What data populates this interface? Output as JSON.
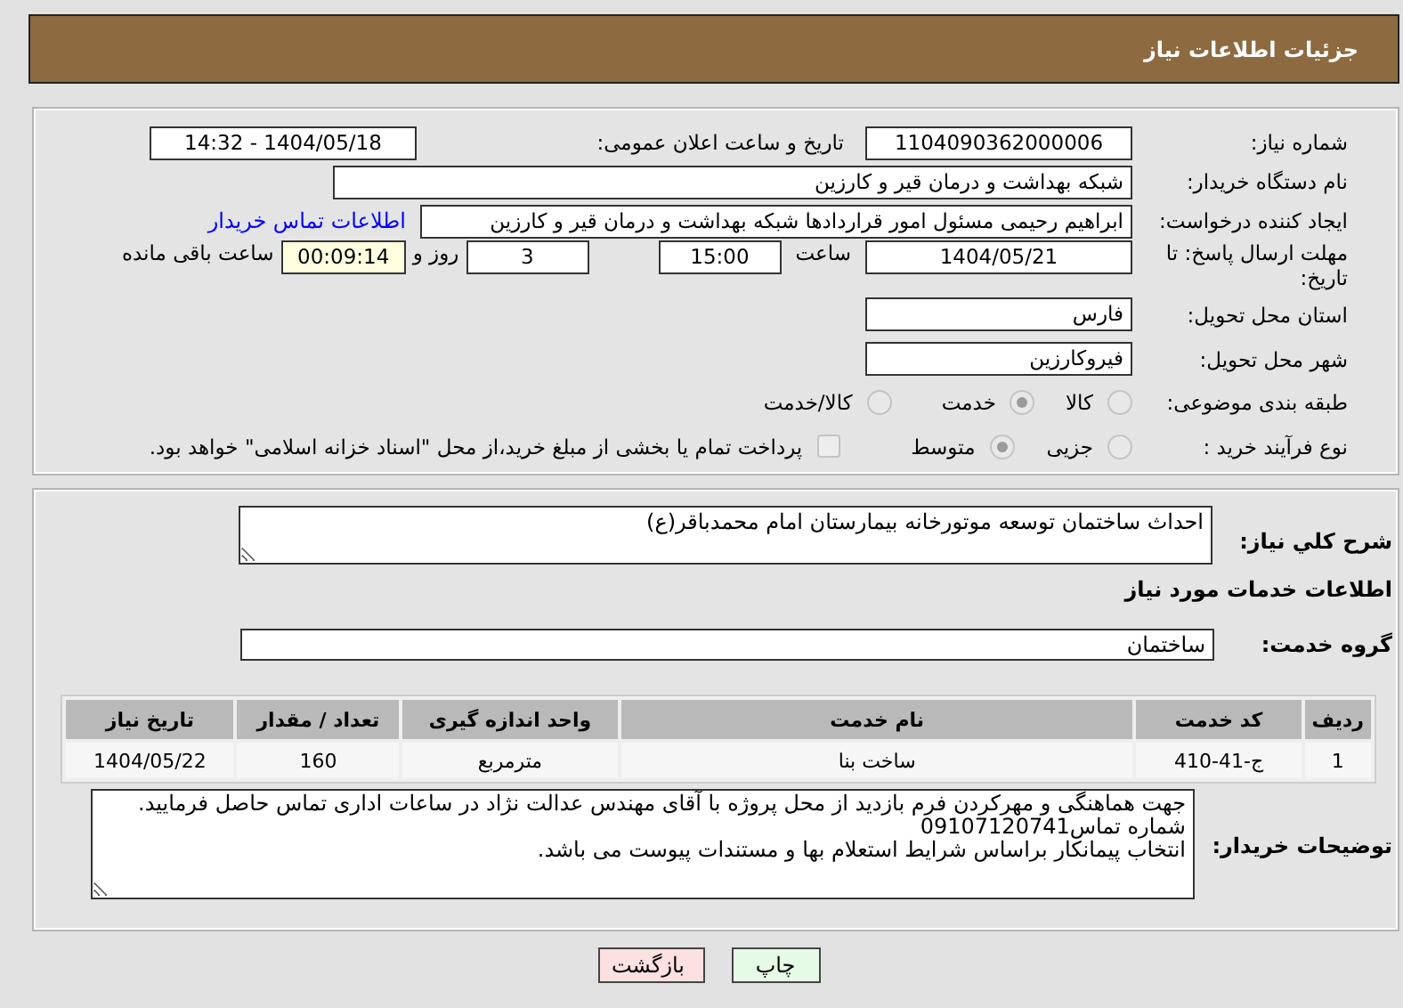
{
  "header": {
    "title": "جزئیات اطلاعات نیاز"
  },
  "details": {
    "need_number": {
      "label": "شماره نیاز:",
      "value": "1104090362000006"
    },
    "announce": {
      "label": "تاریخ و ساعت اعلان عمومی:",
      "value": "1404/05/18 - 14:32"
    },
    "buyer": {
      "label": "نام دستگاه خریدار:",
      "value": "شبکه بهداشت و درمان قیر و کارزین"
    },
    "creator": {
      "label": "ایجاد کننده درخواست:",
      "value": "ابراهیم رحیمی مسئول امور قراردادها شبکه بهداشت و درمان قیر و کارزین",
      "link": "اطلاعات تماس خریدار"
    },
    "deadline": {
      "label": "مهلت ارسال پاسخ: تا تاریخ:",
      "date": "1404/05/21",
      "time_label": "ساعت",
      "time": "15:00",
      "days": "3",
      "days_label": "روز و",
      "remaining": "00:09:14",
      "remaining_label": "ساعت باقی مانده"
    },
    "province": {
      "label": "استان محل تحویل:",
      "value": "فارس"
    },
    "city": {
      "label": "شهر محل تحویل:",
      "value": "فیروکارزین"
    },
    "category": {
      "label": "طبقه بندی موضوعی:",
      "options": [
        {
          "label": "کالا",
          "selected": false
        },
        {
          "label": "خدمت",
          "selected": true
        },
        {
          "label": "کالا/خدمت",
          "selected": false
        }
      ]
    },
    "process": {
      "label": "نوع فرآیند خرید :",
      "options": [
        {
          "label": "جزیی",
          "selected": false
        },
        {
          "label": "متوسط",
          "selected": true
        }
      ],
      "payment": {
        "label": "پرداخت تمام یا بخشی از مبلغ خرید،از محل \"اسناد خزانه اسلامی\" خواهد بود.",
        "checked": false
      }
    }
  },
  "services": {
    "summary": {
      "label": "شرح کلي نیاز:",
      "value": "احداث ساختمان توسعه موتورخانه بیمارستان امام محمدباقر(ع)"
    },
    "section_title": "اطلاعات خدمات مورد نیاز",
    "group": {
      "label": "گروه خدمت:",
      "value": "ساختمان"
    },
    "table": {
      "columns": [
        "ردیف",
        "کد خدمت",
        "نام خدمت",
        "واحد اندازه گیری",
        "تعداد / مقدار",
        "تاریخ نیاز"
      ],
      "rows": [
        [
          "1",
          "ج-41-410",
          "ساخت بنا",
          "مترمربع",
          "160",
          "1404/05/22"
        ]
      ]
    },
    "notes": {
      "label": "توضیحات خریدار:",
      "lines": [
        "جهت هماهنگی و مهرکردن فرم بازدید از محل پروژه با آقای مهندس عدالت نژاد در ساعات اداری تماس حاصل فرمایید.",
        "شماره تماس09107120741",
        "انتخاب پیمانکار براساس شرایط استعلام بها و مستندات پیوست می باشد."
      ]
    }
  },
  "buttons": [
    {
      "label": "چاپ",
      "kind": "print"
    },
    {
      "label": "بازگشت",
      "kind": "back"
    }
  ]
}
